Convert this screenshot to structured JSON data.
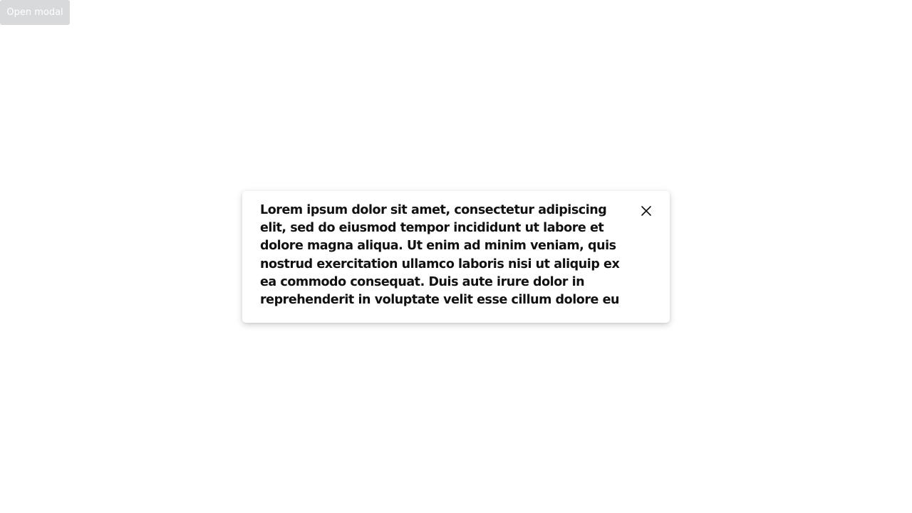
{
  "toolbar": {
    "open_modal_label": "Open modal"
  },
  "modal": {
    "body_text": "Lorem ipsum dolor sit amet, consectetur adipiscing elit, sed do eiusmod tempor incididunt ut labore et dolore magna aliqua. Ut enim ad minim veniam, quis nostrud exercitation ullamco laboris nisi ut aliquip ex ea commodo consequat. Duis aute irure dolor in reprehenderit in voluptate velit esse cillum dolore eu fugiat nulla pariatur. Excepteur sint occaecat",
    "close_icon": "close-icon"
  },
  "colors": {
    "button_bg": "#d7d9db",
    "button_text": "#ffffff",
    "modal_bg": "#ffffff",
    "text": "#111111"
  }
}
